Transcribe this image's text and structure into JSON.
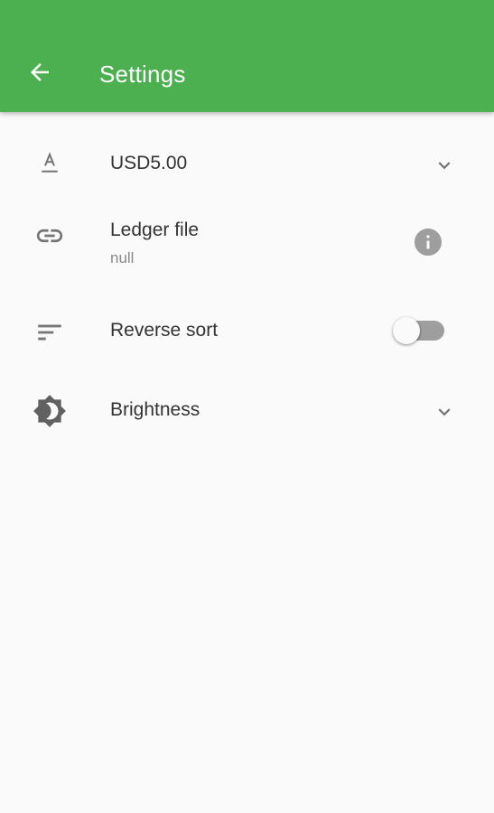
{
  "appbar": {
    "title": "Settings",
    "back_icon": "arrow-back-icon",
    "color": "#4caf50"
  },
  "settings": [
    {
      "icon": "currency-format-icon",
      "title": "USD5.00",
      "trailing": "chevron-down-icon"
    },
    {
      "icon": "link-icon",
      "title": "Ledger file",
      "subtitle": "null",
      "trailing": "info-icon"
    },
    {
      "icon": "sort-icon",
      "title": "Reverse sort",
      "trailing": "toggle-switch",
      "toggle_on": false
    },
    {
      "icon": "brightness-icon",
      "title": "Brightness",
      "trailing": "chevron-down-icon"
    }
  ]
}
